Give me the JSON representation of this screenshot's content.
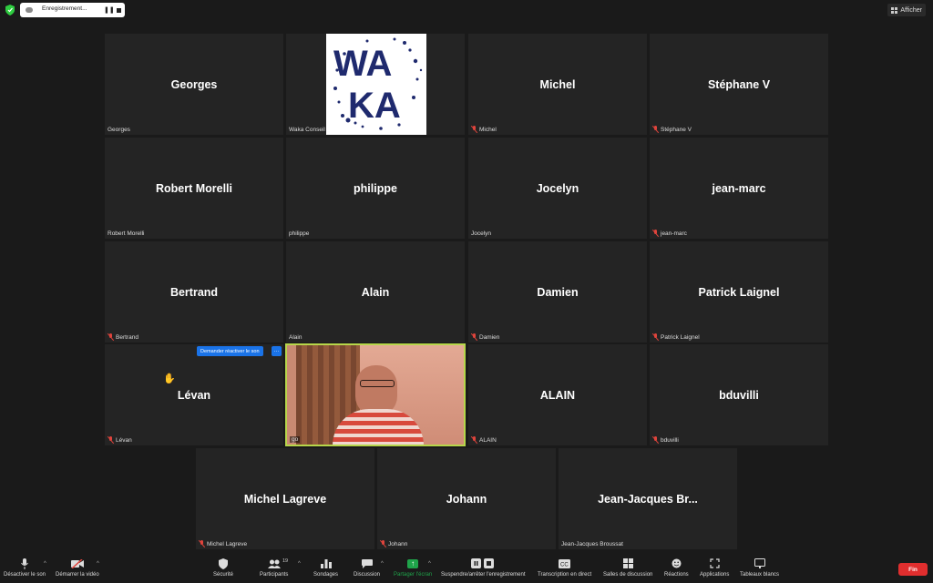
{
  "topbar": {
    "recording_label": "Enregistrement...",
    "view_label": "Afficher"
  },
  "participants": [
    {
      "name": "Georges",
      "label": "Georges",
      "muted": false
    },
    {
      "name": "",
      "label": "Waka Conseil",
      "muted": false,
      "logo": "WAKA"
    },
    {
      "name": "Michel",
      "label": "Michel",
      "muted": true
    },
    {
      "name": "Stéphane V",
      "label": "Stéphane V",
      "muted": true
    },
    {
      "name": "Robert Morelli",
      "label": "Robert Morelli",
      "muted": false
    },
    {
      "name": "philippe",
      "label": "philippe",
      "muted": false
    },
    {
      "name": "Jocelyn",
      "label": "Jocelyn",
      "muted": false
    },
    {
      "name": "jean-marc",
      "label": "jean-marc",
      "muted": true
    },
    {
      "name": "Bertrand",
      "label": "Bertrand",
      "muted": true
    },
    {
      "name": "Alain",
      "label": "Alain",
      "muted": false
    },
    {
      "name": "Damien",
      "label": "Damien",
      "muted": true
    },
    {
      "name": "Patrick Laignel",
      "label": "Patrick Laignel",
      "muted": true
    },
    {
      "name": "Lévan",
      "label": "Lévan",
      "muted": true,
      "hand_raised": true
    },
    {
      "name": "",
      "label": "go",
      "muted": false,
      "video": true,
      "active_speaker": true
    },
    {
      "name": "ALAIN",
      "label": "ALAIN",
      "muted": true
    },
    {
      "name": "bduvilli",
      "label": "bduvilli",
      "muted": true
    },
    {
      "name": "Michel Lagreve",
      "label": "Michel Lagreve",
      "muted": true
    },
    {
      "name": "Johann",
      "label": "Johann",
      "muted": true
    },
    {
      "name": "Jean-Jacques  Br...",
      "label": "Jean-Jacques Broussat",
      "muted": false
    }
  ],
  "hover": {
    "unmute_request": "Demander réactiver le son",
    "more": "···"
  },
  "logo_text": {
    "line1": "WA",
    "line2": "KA"
  },
  "toolbar": {
    "mute": "Désactiver le son",
    "video": "Démarrer la vidéo",
    "security": "Sécurité",
    "participants": "Participants",
    "participants_count": "19",
    "polls": "Sondages",
    "chat": "Discussion",
    "share": "Partager l'écran",
    "record": "Suspendre/arrêter l'enregistrement",
    "captions": "Transcription en direct",
    "breakout": "Salles de discussion",
    "reactions": "Réactions",
    "apps": "Applications",
    "whiteboards": "Tableaux blancs",
    "end": "Fin"
  },
  "colors": {
    "tile_bg": "#242424",
    "active_border": "#b6d64a",
    "end_button": "#e02e2e",
    "muted_icon": "#e0443c",
    "share_green": "#1fa34a",
    "logo_navy": "#1f2a6e"
  }
}
